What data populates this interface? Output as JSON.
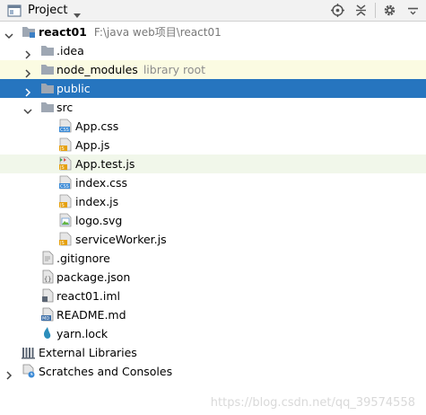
{
  "toolbar": {
    "title": "Project",
    "icons": [
      "project-window-icon",
      "dropdown-icon",
      "locate-icon",
      "collapse-all-icon",
      "settings-icon",
      "hide-icon"
    ]
  },
  "tree": {
    "root": {
      "label": "react01",
      "path": "F:\\java web项目\\react01"
    },
    "idea": "idea",
    "idea_prefix": ".",
    "node_modules": "node_modules",
    "node_modules_hint": "library root",
    "public": "public",
    "src": "src",
    "src_files": [
      "App.css",
      "App.js",
      "App.test.js",
      "index.css",
      "index.js",
      "logo.svg",
      "serviceWorker.js"
    ],
    "root_files": [
      ".gitignore",
      "package.json",
      "react01.iml",
      "README.md",
      "yarn.lock"
    ],
    "external_libraries": "External Libraries",
    "scratches": "Scratches and Consoles"
  },
  "colors": {
    "selection": "#2675bf",
    "css_icon": "#3b8ad6",
    "js_icon": "#e5a00d",
    "folder": "#9ea7b3"
  },
  "watermark": "https://blog.csdn.net/qq_39574558"
}
